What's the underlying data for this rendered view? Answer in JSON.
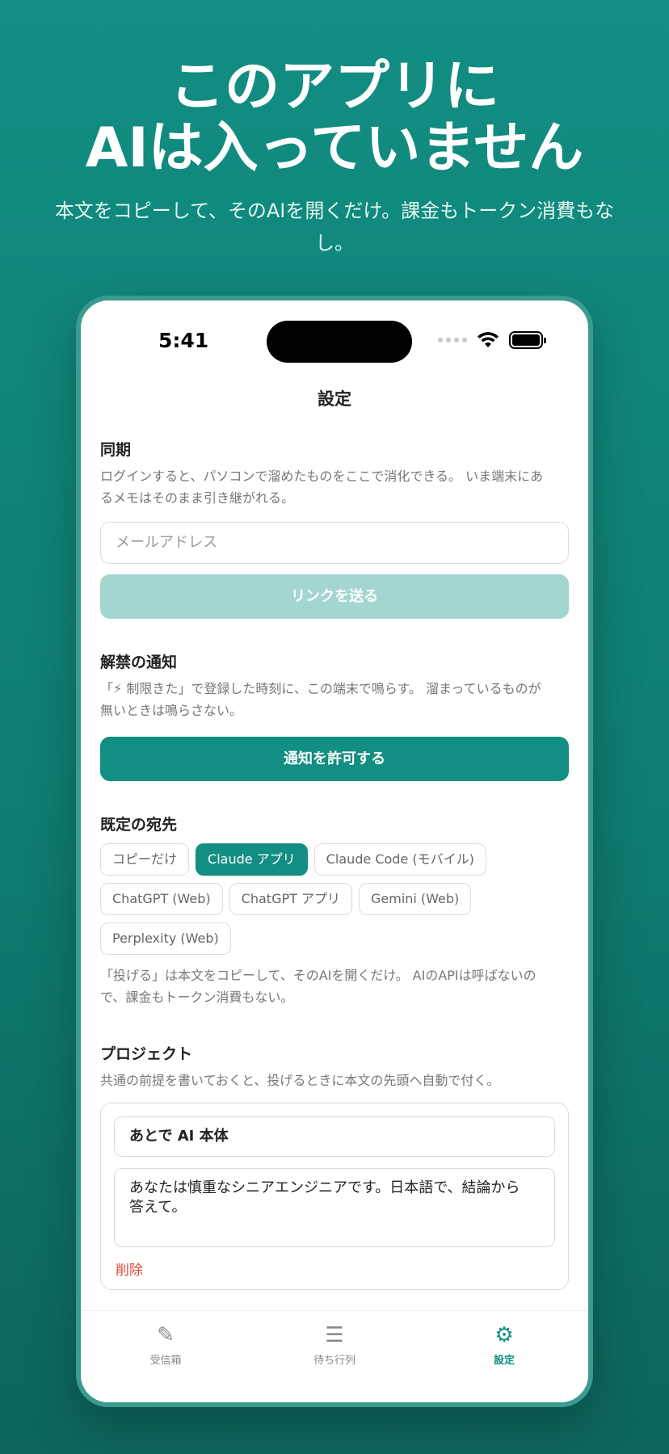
{
  "hero": {
    "title_line1": "このアプリに",
    "title_line2": "AIは入っていません",
    "subtitle_line1": "本文をコピーして、そのAIを開くだけ。課金もトークン消費もな",
    "subtitle_line2": "し。"
  },
  "status_bar": {
    "time": "5:41"
  },
  "screen": {
    "title": "設定"
  },
  "sync": {
    "title": "同期",
    "desc_line1": "ログインすると、パソコンで溜めたものをここで消化できる。 いま端末にあ",
    "desc_line2": "るメモはそのまま引き継がれる。",
    "email_placeholder": "メールアドレス",
    "send_button": "リンクを送る"
  },
  "notification": {
    "title": "解禁の通知",
    "desc_line1": "「⚡ 制限きた」で登録した時刻に、この端末で鳴らす。 溜まっているものが",
    "desc_line2": "無いときは鳴らさない。",
    "allow_button": "通知を許可する"
  },
  "destination": {
    "title": "既定の宛先",
    "options": [
      "コピーだけ",
      "Claude アプリ",
      "Claude Code (モバイル)",
      "ChatGPT (Web)",
      "ChatGPT アプリ",
      "Gemini (Web)",
      "Perplexity (Web)"
    ],
    "selected": "Claude アプリ",
    "note_line1": "「投げる」は本文をコピーして、そのAIを開くだけ。 AIのAPIは呼ばないの",
    "note_line2": "で、課金もトークン消費もない。"
  },
  "project": {
    "title": "プロジェクト",
    "desc": "共通の前提を書いておくと、投げるときに本文の先頭へ自動で付く。",
    "name": "あとで AI 本体",
    "body_line1": "あなたは慎重なシニアエンジニアです。日本語で、結論から",
    "body_line2": "答えて。",
    "delete": "削除"
  },
  "tabs": [
    {
      "label": "受信箱",
      "icon": "pencil-icon"
    },
    {
      "label": "待ち行列",
      "icon": "list-icon"
    },
    {
      "label": "設定",
      "icon": "gear-icon"
    }
  ],
  "colors": {
    "accent": "#128e82",
    "accent_disabled": "#a3d6cf",
    "danger": "#e0453a"
  }
}
